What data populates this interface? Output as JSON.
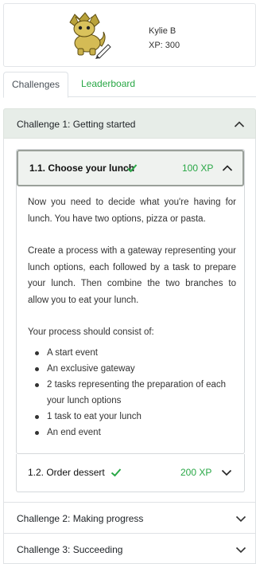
{
  "profile": {
    "name": "Kylie B",
    "xp": "XP: 300",
    "avatar_icon": "dinosaur-avatar-icon",
    "edit_icon": "pencil-icon"
  },
  "tabs": [
    {
      "label": "Challenges",
      "active": true
    },
    {
      "label": "Leaderboard",
      "active": false
    }
  ],
  "challenges": [
    {
      "title": "Challenge 1: Getting started",
      "expanded": true,
      "tasks": [
        {
          "title": "1.1. Choose your lunch",
          "completed": true,
          "xp": "100 XP",
          "expanded": true,
          "description": [
            "Now you need to decide what you're having for lunch. You have two options, pizza or pasta.",
            "Create a process with a gateway representing your lunch options, each followed by a task to prepare your lunch. Then combine the two branches to allow you to eat your lunch.",
            "Your process should consist of:"
          ],
          "requirements": [
            "A start event",
            "An exclusive gateway",
            "2 tasks representing the preparation of each your lunch options",
            "1 task to eat your lunch",
            "An end event"
          ]
        },
        {
          "title": "1.2. Order dessert",
          "completed": true,
          "xp": "200 XP",
          "expanded": false
        }
      ]
    },
    {
      "title": "Challenge 2: Making progress",
      "expanded": false
    },
    {
      "title": "Challenge 3: Succeeding",
      "expanded": false
    }
  ],
  "colors": {
    "accent": "#28a745",
    "header_bg": "#e7ede8",
    "check": "#28a745"
  }
}
